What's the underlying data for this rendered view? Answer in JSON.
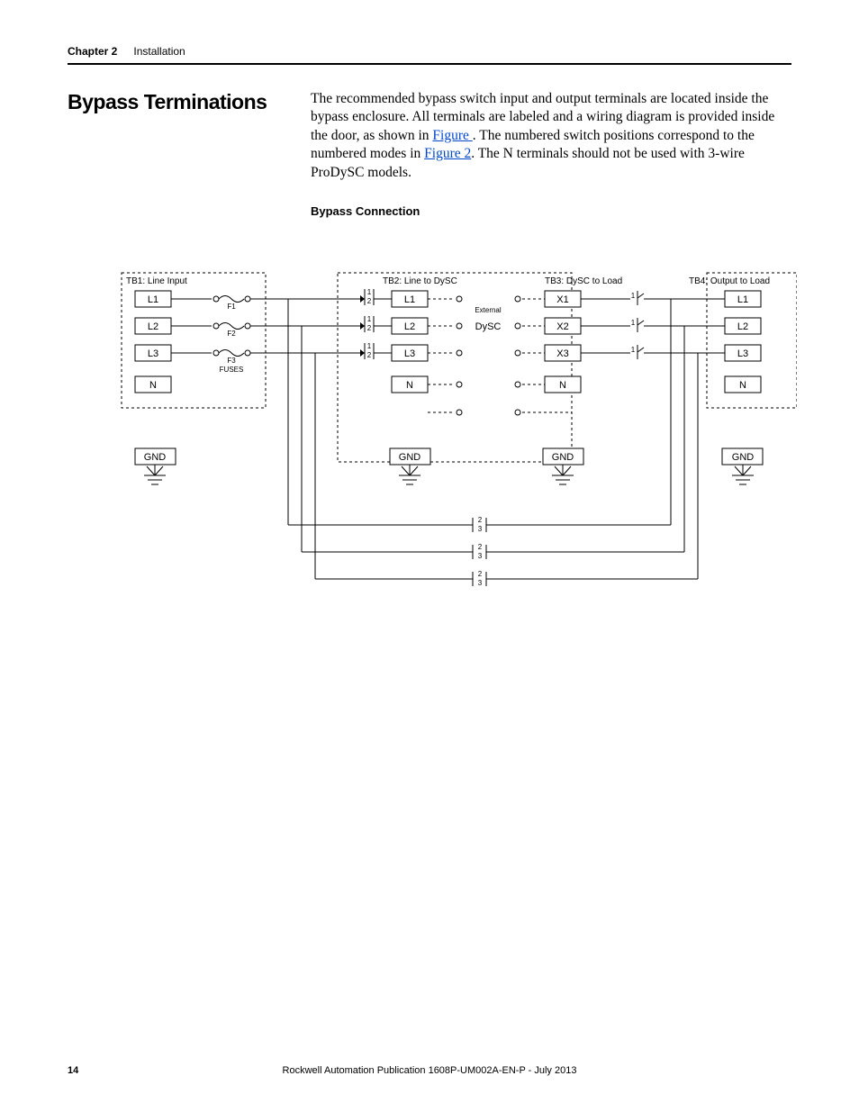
{
  "header": {
    "chapter": "Chapter 2",
    "title": "Installation"
  },
  "section": {
    "title": "Bypass Terminations",
    "para_before_link1": "The recommended bypass switch input and output terminals are located inside the bypass enclosure. All terminals are labeled and a wiring diagram is provided inside the door, as shown in ",
    "link1": "Figure ",
    "para_mid": ". The numbered switch positions correspond to the numbered modes in ",
    "link2": "Figure 2",
    "para_after": ". The N terminals should not be used with 3-wire ProDySC models.",
    "figure_caption": "Bypass Connection"
  },
  "diagram": {
    "tb1": {
      "label": "TB1: Line Input",
      "terms": [
        "L1",
        "L2",
        "L3",
        "N"
      ],
      "fuses": [
        "F1",
        "F2",
        "F3",
        "FUSES"
      ]
    },
    "tb2": {
      "label": "TB2: Line to DySC",
      "terms": [
        "L1",
        "L2",
        "L3",
        "N"
      ],
      "sw": [
        "1",
        "2"
      ],
      "center": "External DySC"
    },
    "tb3": {
      "label": "TB3: DySC to Load",
      "terms": [
        "X1",
        "X2",
        "X3",
        "N"
      ],
      "sw": [
        "1"
      ]
    },
    "tb4": {
      "label": "TB4: Output to Load",
      "terms": [
        "L1",
        "L2",
        "L3",
        "N"
      ]
    },
    "gnd": "GND",
    "bypass_sw": [
      "2",
      "3"
    ]
  },
  "footer": {
    "page": "14",
    "pub": "Rockwell Automation Publication 1608P-UM002A-EN-P - July 2013"
  }
}
